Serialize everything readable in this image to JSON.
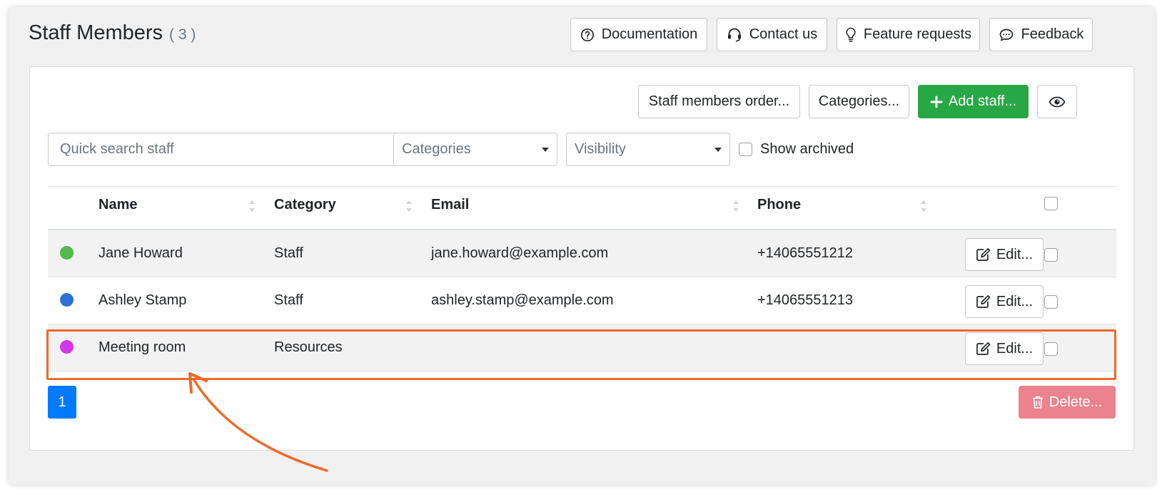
{
  "page": {
    "title": "Staff Members",
    "count": "( 3 )"
  },
  "header_buttons": {
    "documentation": "Documentation",
    "contact": "Contact us",
    "feature": "Feature requests",
    "feedback": "Feedback"
  },
  "toolbar": {
    "order": "Staff members order...",
    "categories": "Categories...",
    "add_staff": "Add staff..."
  },
  "filters": {
    "search_placeholder": "Quick search staff",
    "categories": "Categories",
    "visibility": "Visibility",
    "show_archived": "Show archived"
  },
  "table": {
    "columns": {
      "name": "Name",
      "category": "Category",
      "email": "Email",
      "phone": "Phone"
    },
    "rows": [
      {
        "color": "#52b94f",
        "name": "Jane Howard",
        "category": "Staff",
        "email": "jane.howard@example.com",
        "phone": "+14065551212",
        "edit": "Edit..."
      },
      {
        "color": "#2f6fd8",
        "name": "Ashley Stamp",
        "category": "Staff",
        "email": "ashley.stamp@example.com",
        "phone": "+14065551213",
        "edit": "Edit..."
      },
      {
        "color": "#d536e8",
        "name": "Meeting room",
        "category": "Resources",
        "email": "",
        "phone": "",
        "edit": "Edit..."
      }
    ]
  },
  "pagination": {
    "current": "1"
  },
  "footer": {
    "delete": "Delete..."
  },
  "colors": {
    "accent": "#007bff",
    "success": "#28a745",
    "danger_disabled": "#ea838e",
    "annotation": "#ec6a2c"
  }
}
